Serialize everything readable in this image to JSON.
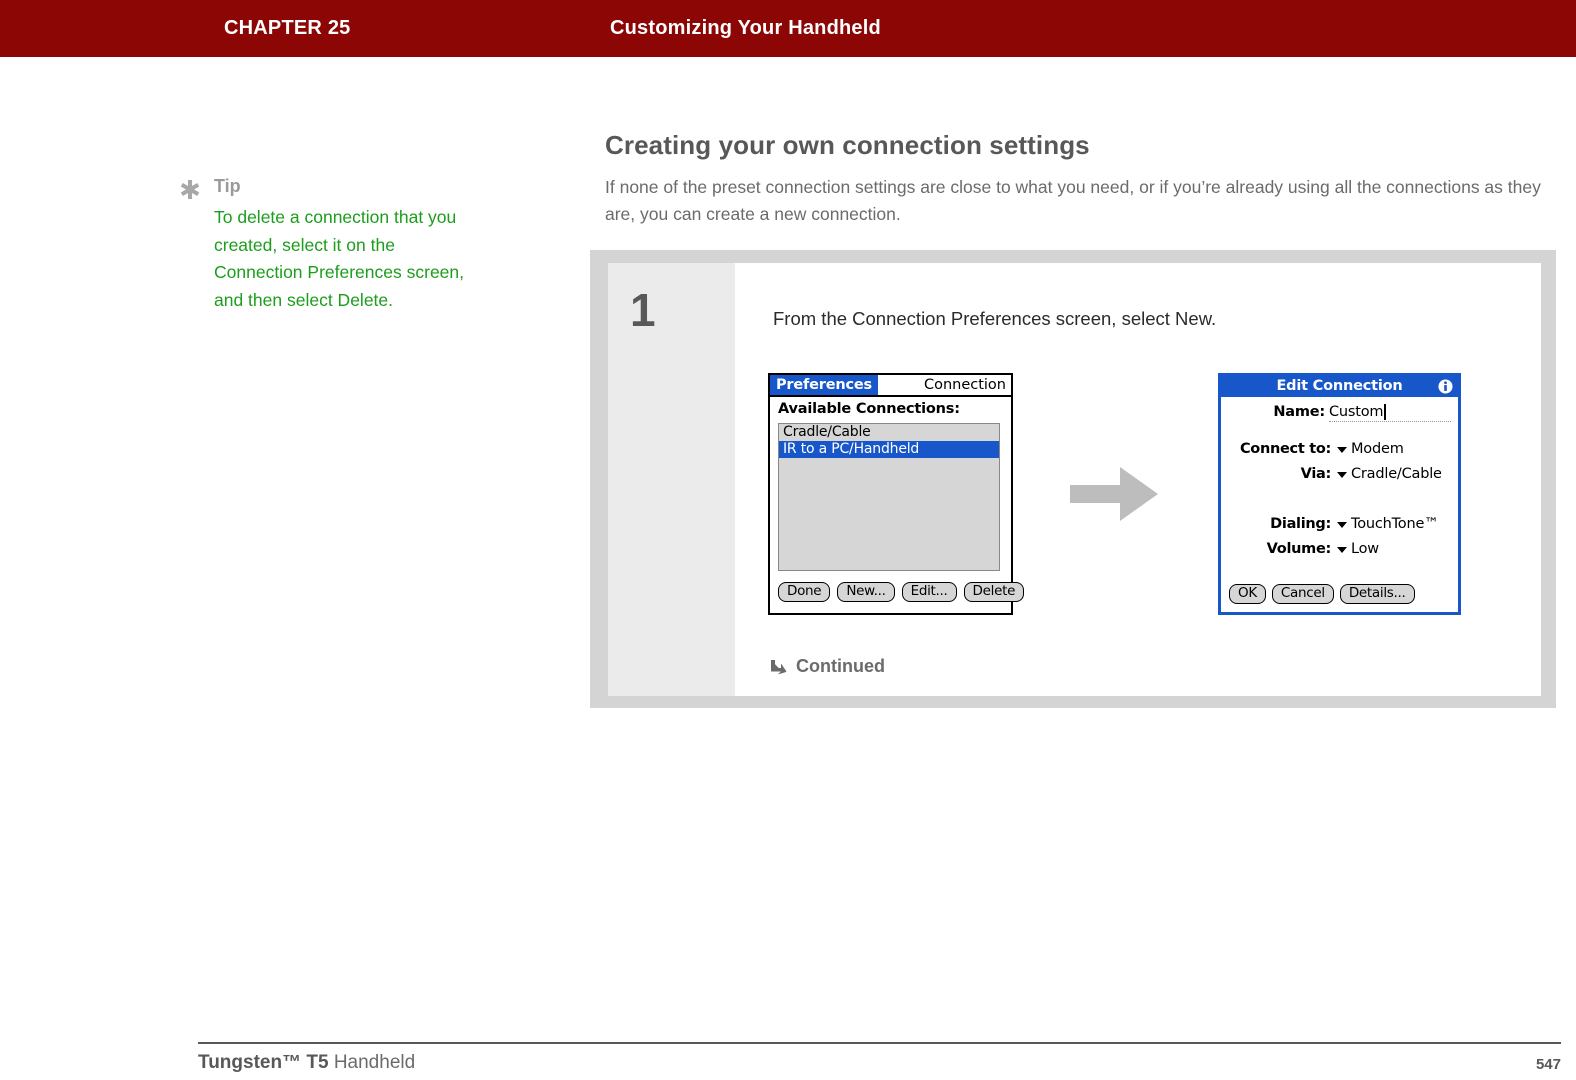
{
  "header": {
    "chapter_label": "CHAPTER 25",
    "chapter_title": "Customizing Your Handheld",
    "bar_color": "#8c0606"
  },
  "tip": {
    "icon": "asterisk-icon",
    "heading": "Tip",
    "body": "To delete a connection that you created, select it on the Connection Preferences screen, and then select Delete.",
    "text_color": "#1c9e1c"
  },
  "main": {
    "section_heading": "Creating your own connection settings",
    "intro": "If none of the preset connection settings are close to what you need, or if you’re already using all the connections as they are, you can create a new connection."
  },
  "step": {
    "number": "1",
    "instruction": "From the Connection Preferences screen, select New.",
    "continued_label": "Continued",
    "continued_icon": "arrow-down-right-icon",
    "transition_icon": "arrow-right-icon"
  },
  "preferences_screen": {
    "tab_title": "Preferences",
    "category": "Connection",
    "subhead": "Available Connections:",
    "list": [
      {
        "label": "Cradle/Cable",
        "selected": false
      },
      {
        "label": "IR to a PC/Handheld",
        "selected": true
      }
    ],
    "buttons": [
      "Done",
      "New...",
      "Edit...",
      "Delete"
    ],
    "highlight_color": "#1757c9"
  },
  "edit_connection_dialog": {
    "title": "Edit Connection",
    "info_icon": "info-icon",
    "name_label": "Name:",
    "name_value": "Custom",
    "fields": [
      {
        "label": "Connect to:",
        "value": "Modem"
      },
      {
        "label": "Via:",
        "value": "Cradle/Cable"
      },
      {
        "label": "Dialing:",
        "value": "TouchTone™"
      },
      {
        "label": "Volume:",
        "value": "Low"
      }
    ],
    "buttons": [
      "OK",
      "Cancel",
      "Details..."
    ],
    "accent_color": "#1757c9"
  },
  "footer": {
    "brand": "Tungsten™ T5",
    "product": " Handheld",
    "page_number": "547"
  }
}
